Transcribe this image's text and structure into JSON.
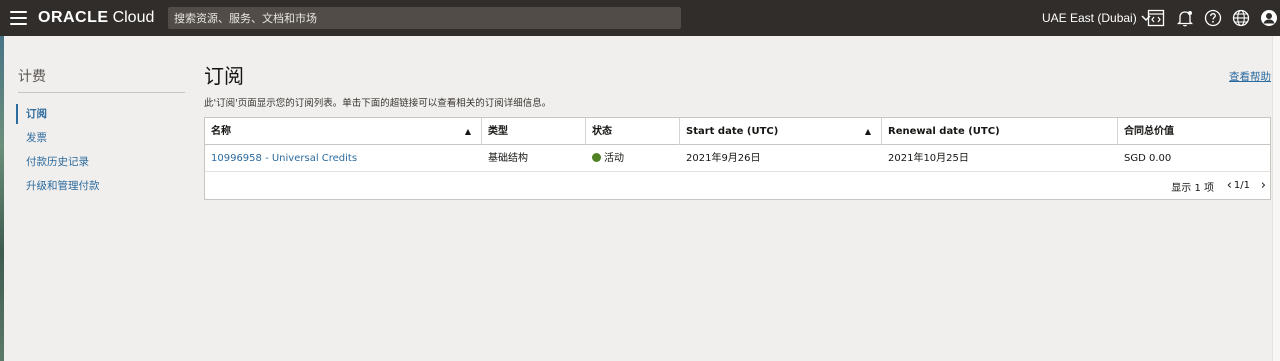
{
  "header": {
    "brand": "ORACLE",
    "product": "Cloud",
    "search_placeholder": "搜索资源、服务、文档和市场",
    "region": "UAE East (Dubai)",
    "icons": [
      "menu-icon",
      "code-editor-icon",
      "bell-icon",
      "help-icon",
      "globe-icon",
      "user-icon"
    ]
  },
  "sidebar": {
    "title": "计费",
    "items": [
      {
        "label": "订阅",
        "active": true
      },
      {
        "label": "发票"
      },
      {
        "label": "付款历史记录"
      },
      {
        "label": "升级和管理付款"
      }
    ]
  },
  "main": {
    "title": "订阅",
    "help_link": "查看帮助",
    "description": "此'订阅'页面显示您的订阅列表。单击下面的超链接可以查看相关的订阅详细信息。",
    "table": {
      "columns": [
        "名称",
        "类型",
        "状态",
        "Start date (UTC)",
        "Renewal date (UTC)",
        "合同总价值"
      ],
      "rows": [
        {
          "name": "10996958 - Universal Credits",
          "type": "基础结构",
          "status": "活动",
          "start_date": "2021年9月26日",
          "renewal_date": "2021年10月25日",
          "contract_value": "SGD 0.00"
        }
      ],
      "footer": {
        "count_label": "显示 1 项",
        "page": "1/1"
      }
    }
  },
  "colors": {
    "header_bg": "#312d2a",
    "link": "#2c6b9e",
    "status_active": "#508223",
    "page_bg": "#f1efed"
  }
}
